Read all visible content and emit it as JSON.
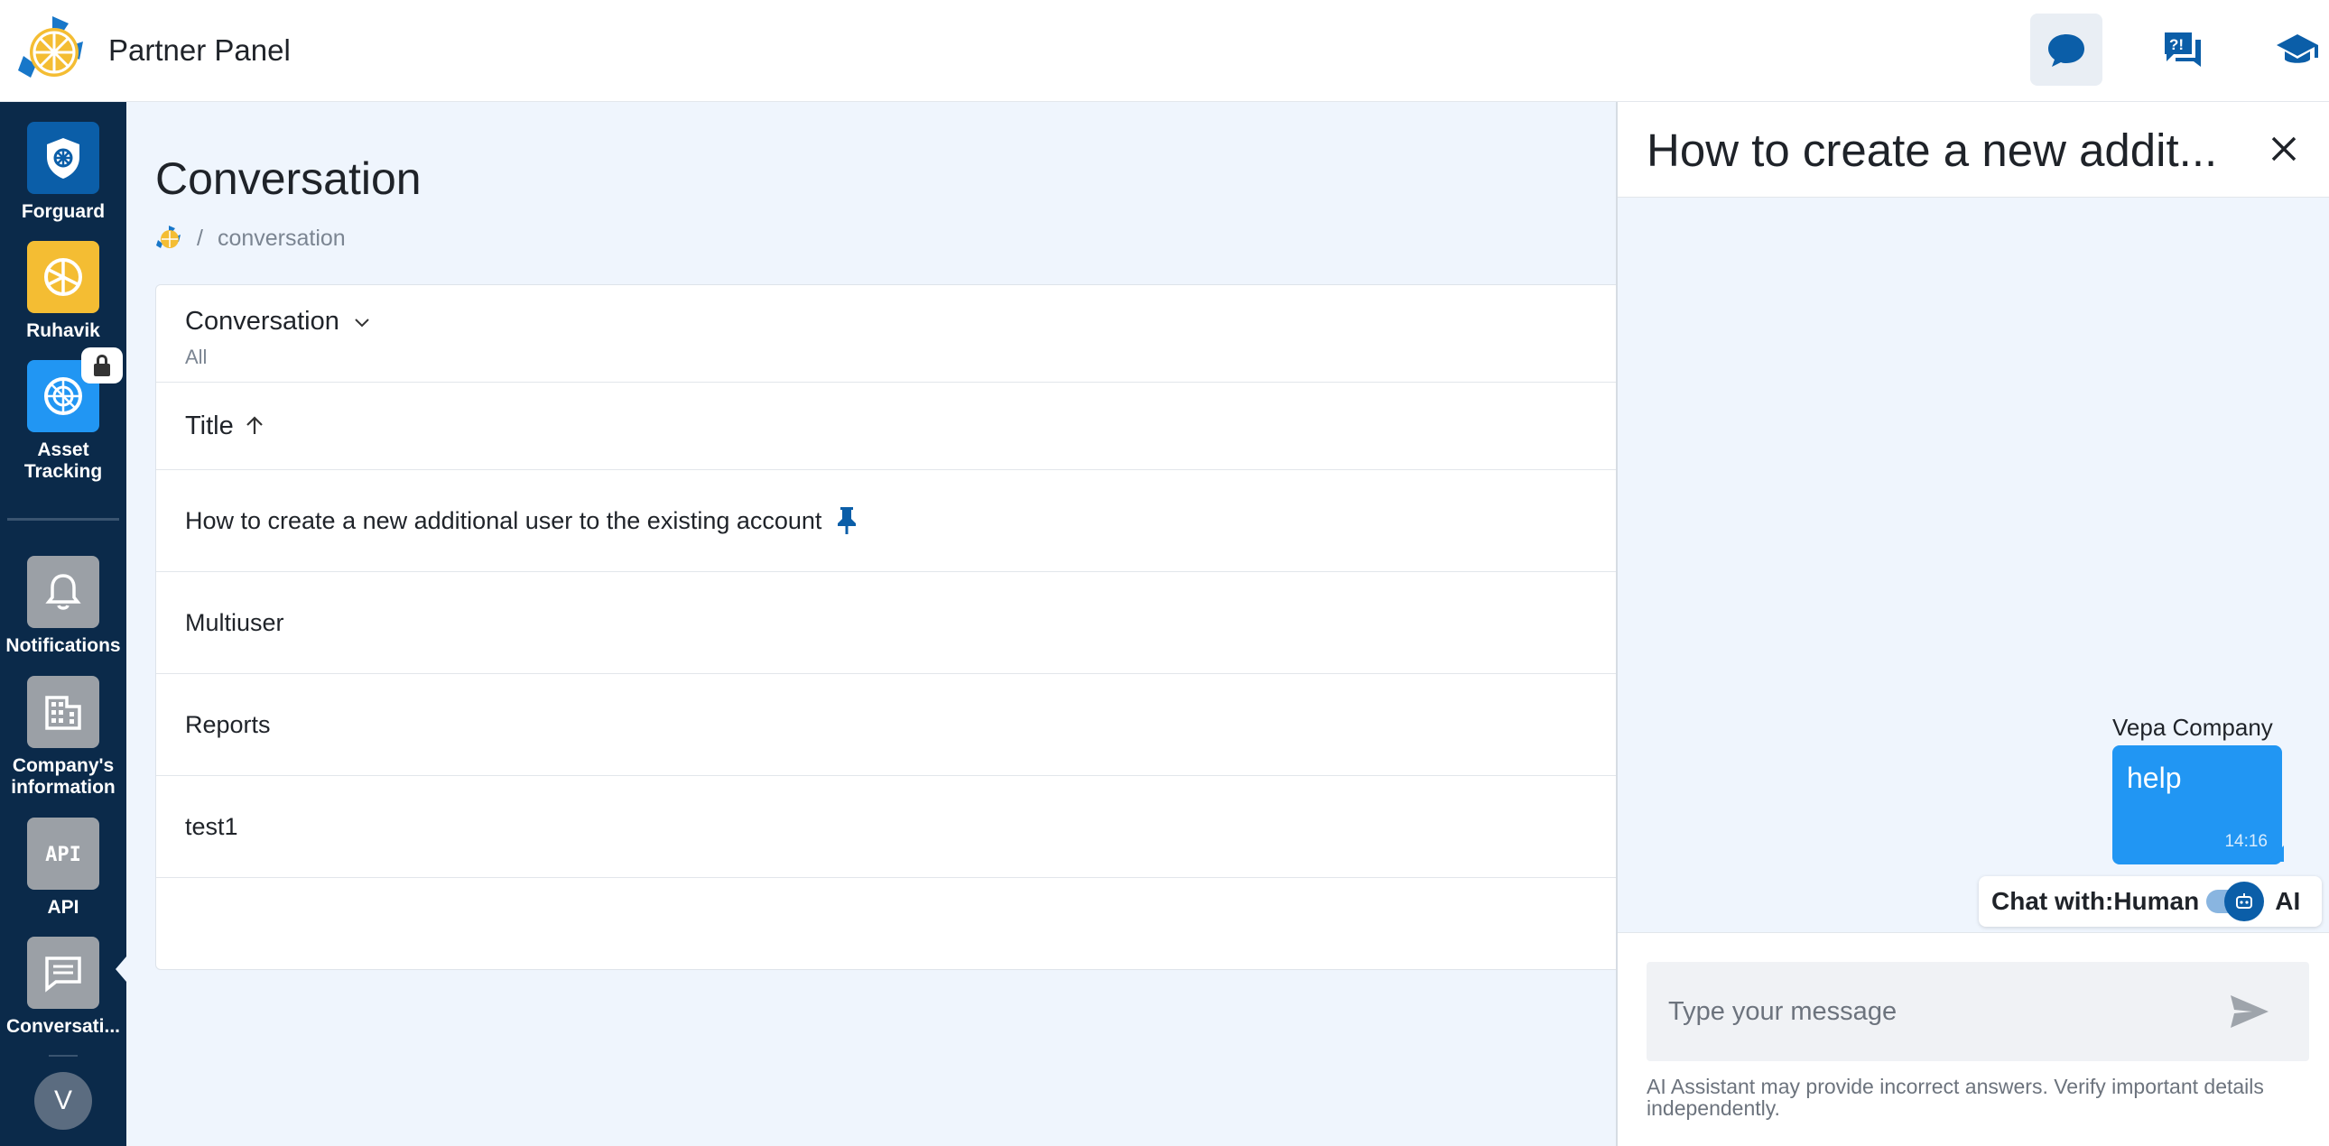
{
  "header": {
    "app_title": "Partner Panel",
    "icons": [
      "chat-bubble-icon",
      "faq-icon",
      "graduation-cap-icon"
    ]
  },
  "sidebar": {
    "apps": [
      {
        "label": "Forguard",
        "icon": "shield-icon",
        "color": "#0b5ea8"
      },
      {
        "label": "Ruhavik",
        "icon": "ruhavik-logo-icon",
        "color": "#f4bd33"
      },
      {
        "label": "Asset Tracking",
        "icon": "asset-tracking-icon",
        "color": "#2196f3",
        "locked": true
      }
    ],
    "tools": [
      {
        "label": "Notifications",
        "icon": "bell-icon"
      },
      {
        "label": "Company's information",
        "icon": "building-icon"
      },
      {
        "label": "API",
        "icon": "api-icon",
        "icon_text": "API"
      },
      {
        "label": "Conversati...",
        "icon": "conversation-icon"
      }
    ],
    "avatar_initial": "V"
  },
  "main": {
    "page_title": "Conversation",
    "breadcrumb": {
      "separator": "/",
      "current": "conversation"
    },
    "filter": {
      "title": "Conversation",
      "subtitle": "All"
    },
    "column_header": "Title",
    "rows": [
      {
        "title": "How to create a new additional user to the existing account",
        "pinned": true
      },
      {
        "title": "Multiuser"
      },
      {
        "title": "Reports"
      },
      {
        "title": "test1"
      }
    ]
  },
  "chat": {
    "title": "How to create a new addit...",
    "message": {
      "sender": "Vepa Company",
      "text": "help",
      "time": "14:16"
    },
    "chat_with": {
      "label": "Chat with:",
      "left_option": "Human",
      "right_option": "AI"
    },
    "input_placeholder": "Type your message",
    "disclaimer": "AI Assistant may provide incorrect answers. Verify important details independently.",
    "accent_color": "#2196f3"
  }
}
